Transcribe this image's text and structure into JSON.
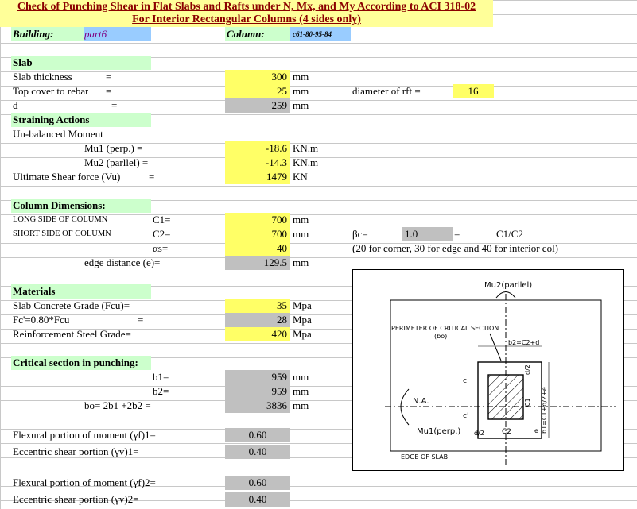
{
  "title_line1": "Check of Punching Shear in Flat Slabs and Rafts under N, Mx, and My According to ACI 318-02",
  "title_line2": "For Interior Rectangular  Columns (4 sides only)",
  "building_label": "Building:",
  "building_value": "part6",
  "column_label": "Column:",
  "column_value": "c61-80-95-84",
  "slab": {
    "heading": "Slab",
    "thickness_label": "Slab thickness",
    "thickness_value": "300",
    "cover_label": "Top cover to rebar",
    "cover_value": "25",
    "d_label": "d",
    "d_value": "259",
    "eq": "=",
    "unit_mm": "mm",
    "rft_label": "diameter of rft  =",
    "rft_value": "16"
  },
  "straining": {
    "heading": "Straining Actions",
    "moment_label": "Un-balanced Moment",
    "mu1_label": "Mu1 (perp.)  =",
    "mu1_value": "-18.6",
    "mu2_label": "Mu2 (parllel) =",
    "mu2_value": "-14.3",
    "unit_knm": "KN.m",
    "vu_label": "Ultimate Shear force (Vu)",
    "vu_value": "1479",
    "unit_kn": "KN"
  },
  "column_dims": {
    "heading": "Column Dimensions:",
    "long_label": "LONG SIDE OF COLUMN",
    "c1_label": "C1=",
    "c1_value": "700",
    "short_label": "SHORT SIDE OF COLUMN",
    "c2_label": "C2=",
    "c2_value": "700",
    "as_label": "αs=",
    "as_value": "40",
    "edge_label": "edge distance (e)=",
    "edge_value": "129.5",
    "bc_label": "βc=",
    "bc_value": "1.0",
    "bc_eq": "=",
    "bc_formula": "C1/C2",
    "as_note": "(20 for corner, 30 for edge and 40 for interior col)"
  },
  "materials": {
    "heading": "Materials",
    "fcu_label": "Slab Concrete Grade (Fcu)=",
    "fcu_value": "35",
    "fc_label": "Fc'=0.80*Fcu",
    "fc_value": "28",
    "fy_label": "Reinforcement Steel Grade=",
    "fy_value": "420",
    "unit_mpa": "Mpa"
  },
  "critical": {
    "heading": "Critical section in punching:",
    "b1_label": "b1=",
    "b1_value": "959",
    "b2_label": "b2=",
    "b2_value": "959",
    "bo_label": "bo= 2b1 +2b2 =",
    "bo_value": "3836",
    "gf1_label": "Flexural portion of moment (γf)1=",
    "gf1_value": "0.60",
    "gv1_label": "Eccentric shear portion (γv)1=",
    "gv1_value": "0.40",
    "gf2_label": "Flexural portion of moment (γf)2=",
    "gf2_value": "0.60",
    "gv2_label": "Eccentric shear portion (γv)2=",
    "gv2_value": "0.40"
  },
  "diagram": {
    "mu2": "Mu2(parllel)",
    "perimeter": "PERIMETER OF CRITICAL SECTION",
    "bo": "(bo)",
    "b2": "b2=C2+d",
    "na": "N.A.",
    "mu1": "Mu1(perp.)",
    "edge": "EDGE OF SLAB",
    "d2a": "d/2",
    "c2": "C2",
    "d2b": "d/2",
    "c1": "C1",
    "b1": "b1=C1+d/2+e",
    "c": "c",
    "cp": "c'",
    "e": "e"
  }
}
